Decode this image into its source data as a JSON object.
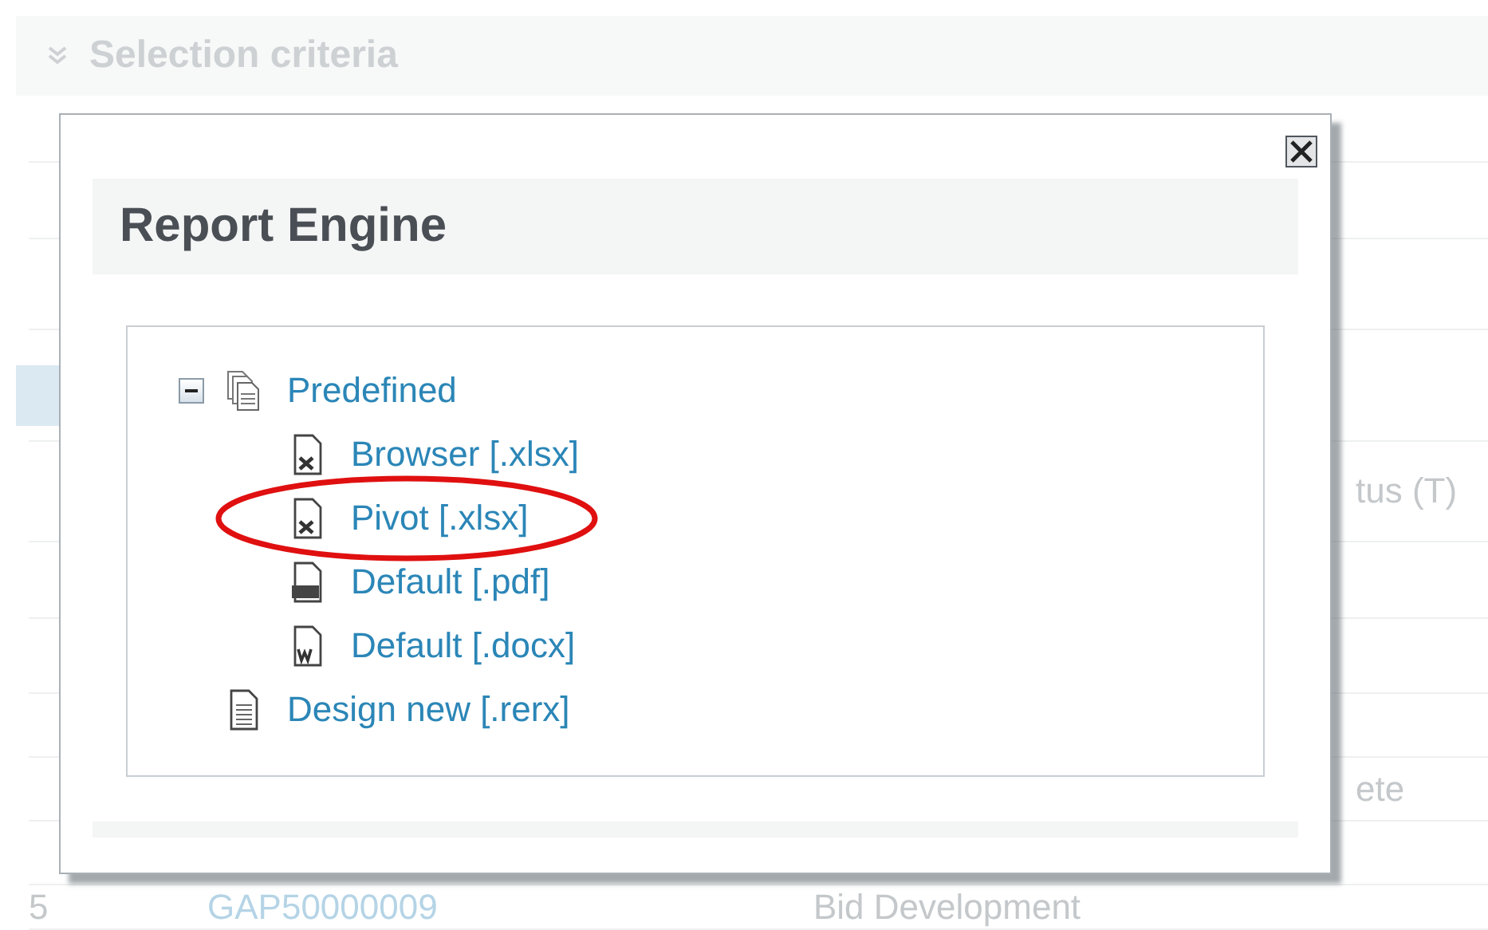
{
  "background": {
    "criteria_bar": {
      "label": "Selection criteria"
    },
    "table": {
      "columns": [
        {
          "label": "tus (T)"
        }
      ],
      "rows": [
        {
          "column_4": "ete"
        },
        {
          "column_1": "5",
          "column_2": "GAP50000009",
          "column_3": "Bid Development"
        }
      ]
    }
  },
  "dialog": {
    "title": "Report Engine",
    "tree": [
      {
        "label": "Predefined",
        "kind": "stack",
        "expanded": true,
        "children": [
          {
            "label": "Browser [.xlsx]",
            "kind": "excel",
            "highlighted": false
          },
          {
            "label": "Pivot [.xlsx]",
            "kind": "excel",
            "highlighted": true
          },
          {
            "label": "Default [.pdf]",
            "kind": "pdf",
            "highlighted": false
          },
          {
            "label": "Default [.docx]",
            "kind": "word",
            "highlighted": false
          }
        ]
      },
      {
        "label": "Design new [.rerx]",
        "kind": "document"
      }
    ]
  }
}
